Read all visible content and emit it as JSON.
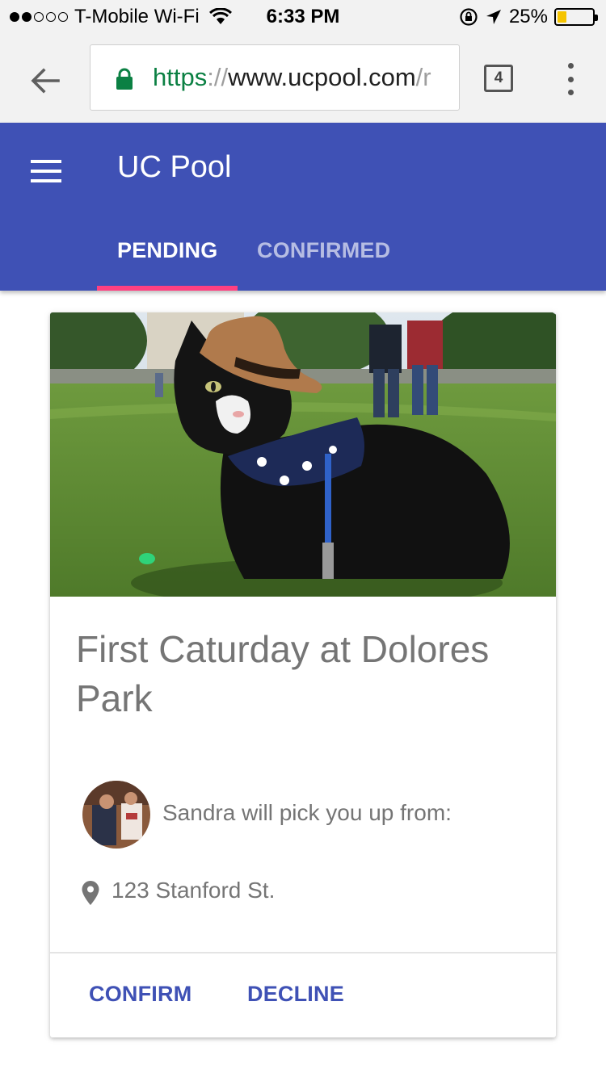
{
  "status_bar": {
    "carrier": "T-Mobile Wi-Fi",
    "time": "6:33 PM",
    "battery": "25%",
    "battery_level": 0.25,
    "signal_bars_filled": 2,
    "signal_bars_total": 5
  },
  "browser": {
    "url_scheme": "https",
    "url_separator": "://",
    "url_host": "www.ucpool.com",
    "url_tail": "/r",
    "tab_count": "4"
  },
  "app": {
    "title": "UC Pool",
    "primary_color": "#3f51b5",
    "accent_color": "#ff4081",
    "tabs": [
      {
        "label": "PENDING",
        "active": true
      },
      {
        "label": "CONFIRMED",
        "active": false
      }
    ]
  },
  "card": {
    "title": "First Caturday at Dolores Park",
    "driver_text": "Sandra will pick you up from:",
    "address": "123 Stanford St.",
    "actions": {
      "confirm": "CONFIRM",
      "decline": "DECLINE"
    }
  },
  "icons": {
    "back": "arrow-left-icon",
    "lock": "lock-icon",
    "menu": "hamburger-icon",
    "overflow": "more-vert-icon",
    "location": "place-icon"
  }
}
